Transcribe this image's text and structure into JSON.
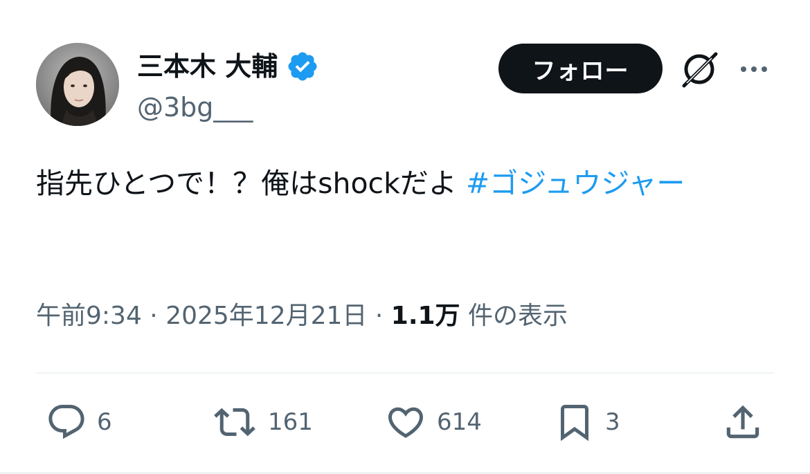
{
  "author": {
    "display_name": "三本木 大輔",
    "handle": "@3bg___",
    "verified": true
  },
  "actions": {
    "follow_label": "フォロー"
  },
  "tweet": {
    "text": "指先ひとつで！？俺はshockだよ ",
    "hashtag": "#ゴジュウジャー"
  },
  "meta": {
    "time": "午前9:34",
    "separator": " · ",
    "date": "2025年12月21日",
    "views_count": "1.1万",
    "views_label": " 件の表示"
  },
  "engagement": {
    "replies": "6",
    "reposts": "161",
    "likes": "614",
    "bookmarks": "3"
  },
  "icons": {
    "verified": "verified-badge-icon",
    "grok": "grok-icon",
    "more": "more-icon",
    "reply": "reply-icon",
    "repost": "repost-icon",
    "like": "heart-icon",
    "bookmark": "bookmark-icon",
    "share": "share-icon"
  },
  "colors": {
    "link": "#1d9bf0",
    "secondary_text": "#536471",
    "primary_text": "#0f1419",
    "divider": "#eff3f4"
  }
}
